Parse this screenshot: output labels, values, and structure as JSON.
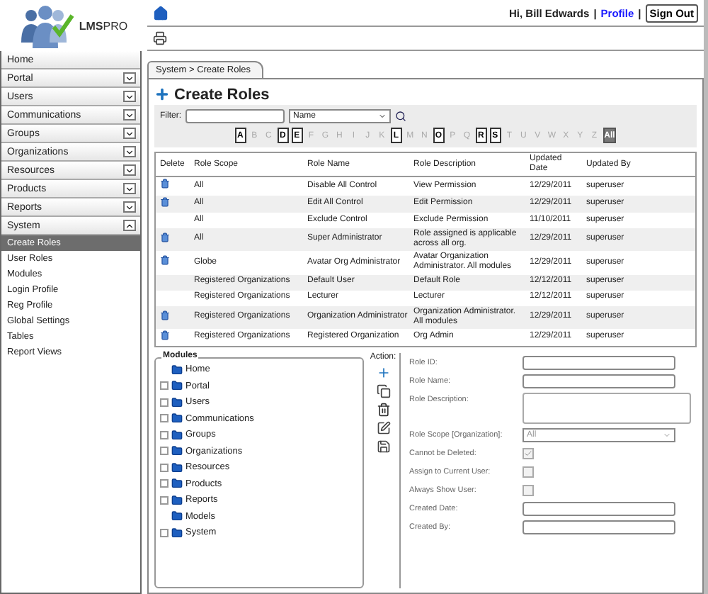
{
  "logo": {
    "text": "**LMS**PRO"
  },
  "header": {
    "greeting": "Hi, Bill Edwards",
    "separator_1": "|",
    "profile_link": "Profile",
    "separator_2": "|",
    "sign_out": "Sign Out"
  },
  "sidebar": {
    "items": [
      {
        "label": "Home",
        "expandable": false
      },
      {
        "label": "Portal",
        "expandable": true,
        "expanded": false
      },
      {
        "label": "Users",
        "expandable": true,
        "expanded": false
      },
      {
        "label": "Communications",
        "expandable": true,
        "expanded": false
      },
      {
        "label": "Groups",
        "expandable": true,
        "expanded": false
      },
      {
        "label": "Organizations",
        "expandable": true,
        "expanded": false
      },
      {
        "label": "Resources",
        "expandable": true,
        "expanded": false
      },
      {
        "label": "Products",
        "expandable": true,
        "expanded": false
      },
      {
        "label": "Reports",
        "expandable": true,
        "expanded": false
      },
      {
        "label": "System",
        "expandable": true,
        "expanded": true,
        "children": [
          {
            "label": "Create Roles",
            "selected": true
          },
          {
            "label": "User Roles",
            "selected": false
          },
          {
            "label": "Modules",
            "selected": false
          },
          {
            "label": "Login Profile",
            "selected": false
          },
          {
            "label": "Reg Profile",
            "selected": false
          },
          {
            "label": "Global Settings",
            "selected": false
          },
          {
            "label": "Tables",
            "selected": false
          },
          {
            "label": "Report Views",
            "selected": false
          }
        ]
      }
    ]
  },
  "breadcrumb_tab": "System > Create Roles",
  "page_title": "Create Roles",
  "filter": {
    "label": "Filter:",
    "value_select": "Name"
  },
  "letters": [
    {
      "label": "A",
      "enabled": true,
      "selected": false
    },
    {
      "label": "B",
      "enabled": false,
      "selected": false
    },
    {
      "label": "C",
      "enabled": false,
      "selected": false
    },
    {
      "label": "D",
      "enabled": true,
      "selected": false
    },
    {
      "label": "E",
      "enabled": true,
      "selected": false
    },
    {
      "label": "F",
      "enabled": false,
      "selected": false
    },
    {
      "label": "G",
      "enabled": false,
      "selected": false
    },
    {
      "label": "H",
      "enabled": false,
      "selected": false
    },
    {
      "label": "I",
      "enabled": false,
      "selected": false
    },
    {
      "label": "J",
      "enabled": false,
      "selected": false
    },
    {
      "label": "K",
      "enabled": false,
      "selected": false
    },
    {
      "label": "L",
      "enabled": true,
      "selected": false
    },
    {
      "label": "M",
      "enabled": false,
      "selected": false
    },
    {
      "label": "N",
      "enabled": false,
      "selected": false
    },
    {
      "label": "O",
      "enabled": true,
      "selected": false
    },
    {
      "label": "P",
      "enabled": false,
      "selected": false
    },
    {
      "label": "Q",
      "enabled": false,
      "selected": false
    },
    {
      "label": "R",
      "enabled": true,
      "selected": false
    },
    {
      "label": "S",
      "enabled": true,
      "selected": false
    },
    {
      "label": "T",
      "enabled": false,
      "selected": false
    },
    {
      "label": "U",
      "enabled": false,
      "selected": false
    },
    {
      "label": "V",
      "enabled": false,
      "selected": false
    },
    {
      "label": "W",
      "enabled": false,
      "selected": false
    },
    {
      "label": "X",
      "enabled": false,
      "selected": false
    },
    {
      "label": "Y",
      "enabled": false,
      "selected": false
    },
    {
      "label": "Z",
      "enabled": false,
      "selected": false
    },
    {
      "label": "All",
      "enabled": true,
      "selected": true
    }
  ],
  "table": {
    "columns": [
      "Delete",
      "Role Scope",
      "Role Name",
      "Role Description",
      "Updated Date",
      "Updated By"
    ],
    "rows": [
      {
        "deletable": true,
        "scope": "All",
        "name": "Disable All Control",
        "description": "View Permission",
        "date": "12/29/2011",
        "by": "superuser"
      },
      {
        "deletable": true,
        "scope": "All",
        "name": "Edit All Control",
        "description": "Edit Permission",
        "date": "12/29/2011",
        "by": "superuser"
      },
      {
        "deletable": false,
        "scope": "All",
        "name": "Exclude Control",
        "description": "Exclude Permission",
        "date": "11/10/2011",
        "by": "superuser"
      },
      {
        "deletable": true,
        "scope": "All",
        "name": "Super Administrator",
        "description": "Role assigned is applicable across all org.",
        "date": "12/29/2011",
        "by": "superuser"
      },
      {
        "deletable": true,
        "scope": "Globe",
        "name": "Avatar Org Administrator",
        "description": "Avatar Organization Administrator. All modules",
        "date": "12/29/2011",
        "by": "superuser"
      },
      {
        "deletable": false,
        "scope": "Registered Organizations",
        "name": "Default User",
        "description": "Default Role",
        "date": "12/12/2011",
        "by": "superuser"
      },
      {
        "deletable": false,
        "scope": "Registered Organizations",
        "name": "Lecturer",
        "description": "Lecturer",
        "date": "12/12/2011",
        "by": "superuser"
      },
      {
        "deletable": true,
        "scope": "Registered Organizations",
        "name": "Organization Administrator",
        "description": "Organization Administrator. All modules",
        "date": "12/29/2011",
        "by": "superuser"
      },
      {
        "deletable": true,
        "scope": "Registered Organizations",
        "name": "Registered Organization",
        "description": "Org Admin",
        "date": "12/29/2011",
        "by": "superuser"
      }
    ]
  },
  "modules": {
    "title": "Modules",
    "items": [
      {
        "label": "Home",
        "expandable": false
      },
      {
        "label": "Portal",
        "expandable": true
      },
      {
        "label": "Users",
        "expandable": true
      },
      {
        "label": "Communications",
        "expandable": true
      },
      {
        "label": "Groups",
        "expandable": true
      },
      {
        "label": "Organizations",
        "expandable": true
      },
      {
        "label": "Resources",
        "expandable": true
      },
      {
        "label": "Products",
        "expandable": true
      },
      {
        "label": "Reports",
        "expandable": true
      },
      {
        "label": "Models",
        "expandable": false
      },
      {
        "label": "System",
        "expandable": true
      }
    ]
  },
  "actions": {
    "label": "Action:",
    "items": [
      {
        "kind": "add"
      },
      {
        "kind": "copy"
      },
      {
        "kind": "delete"
      },
      {
        "kind": "edit"
      },
      {
        "kind": "save"
      }
    ]
  },
  "form": [
    {
      "kind": "text",
      "label": "Role ID:"
    },
    {
      "kind": "text",
      "label": "Role Name:"
    },
    {
      "kind": "textarea",
      "label": "Role Description:"
    },
    {
      "kind": "select",
      "label": "Role Scope [Organization]:",
      "value": "All"
    },
    {
      "kind": "checkbox",
      "label": "Cannot be Deleted:",
      "checked": true,
      "disabled": true
    },
    {
      "kind": "checkbox",
      "label": "Assign to Current User:",
      "checked": false,
      "disabled": true
    },
    {
      "kind": "checkbox",
      "label": "Always Show User:",
      "checked": false,
      "disabled": true
    },
    {
      "kind": "text",
      "label": "Created Date:"
    },
    {
      "kind": "text",
      "label": "Created By:"
    }
  ]
}
